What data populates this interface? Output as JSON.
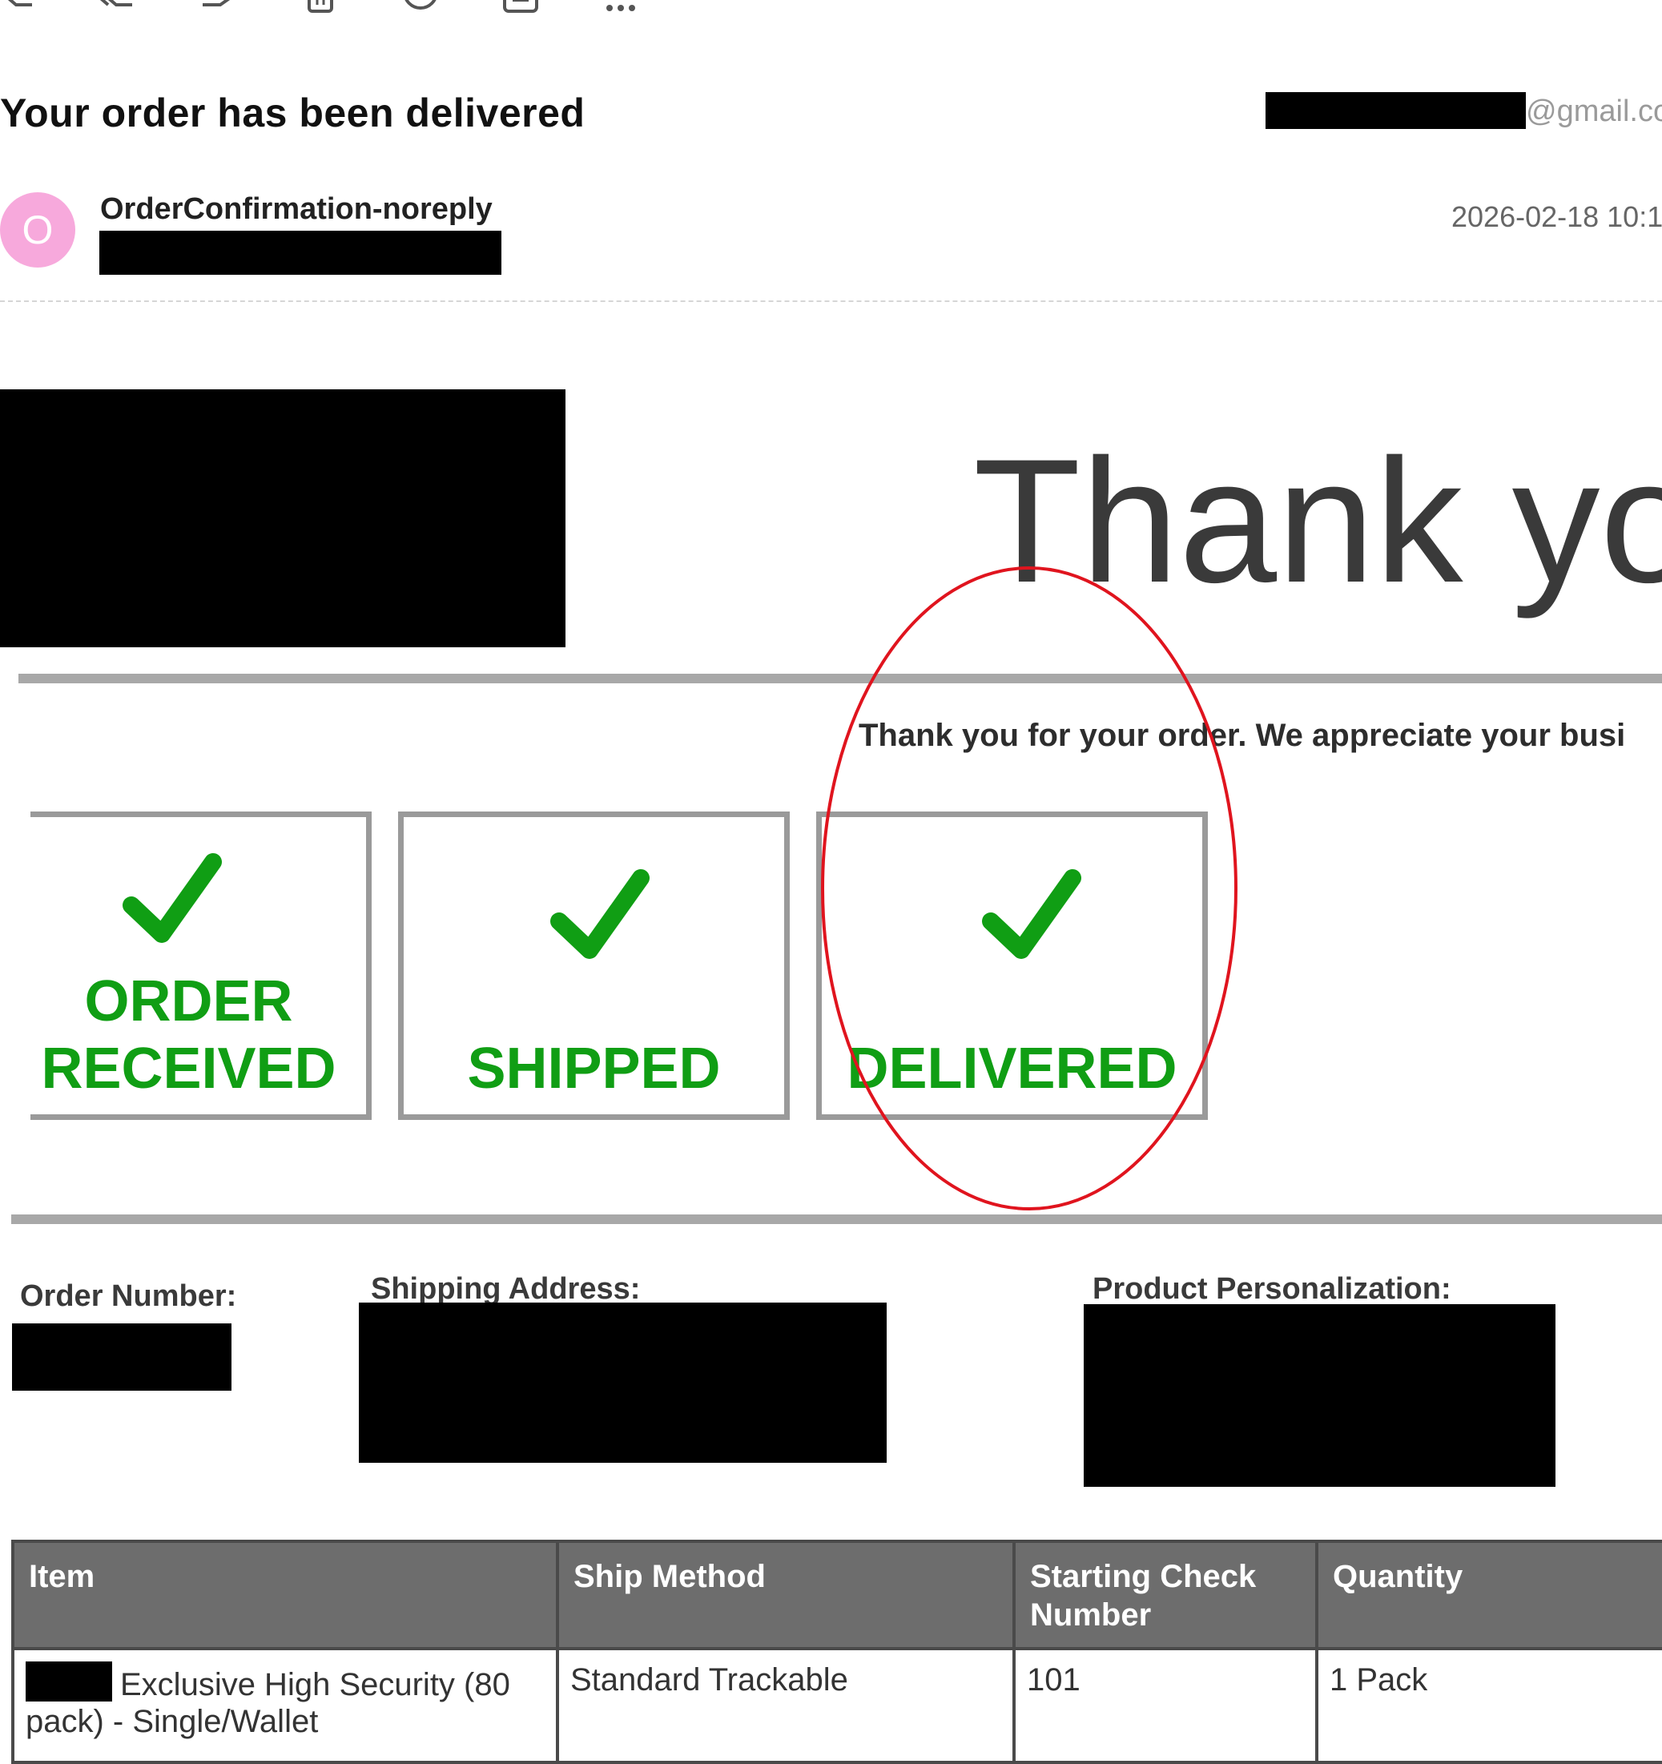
{
  "toolbar": {
    "icons": [
      "reply-icon",
      "reply-all-icon",
      "forward-icon",
      "delete-icon",
      "snooze-icon",
      "archive-icon",
      "more-icon"
    ]
  },
  "email": {
    "subject": "Your order has been delivered",
    "recipient_suffix": "@gmail.con",
    "sender_initial": "O",
    "sender_name": "OrderConfirmation-noreply",
    "date": "2026-02-18 10:1"
  },
  "body": {
    "headline": "Thank yo",
    "appreciation": "Thank you for your order. We appreciate your busi",
    "steps": [
      {
        "line1": "ORDER",
        "line2": "RECEIVED"
      },
      {
        "line1": "",
        "line2": "SHIPPED"
      },
      {
        "line1": "",
        "line2": "DELIVERED"
      }
    ],
    "fields": {
      "order_number_label": "Order Number:",
      "shipping_address_label": "Shipping Address:",
      "personalization_label": "Product Personalization:"
    },
    "table": {
      "headers": [
        "Item",
        "Ship Method",
        "Starting Check Number",
        "Quantity"
      ],
      "rows": [
        [
          "Exclusive High Security (80 pack) - Single/Wallet",
          "Standard Trackable",
          "101",
          "1 Pack"
        ]
      ]
    }
  },
  "colors": {
    "status_green": "#109e14",
    "annotation_red": "#e0141e",
    "avatar_pink": "#f7a9dc",
    "header_gray": "#6d6d6d"
  }
}
